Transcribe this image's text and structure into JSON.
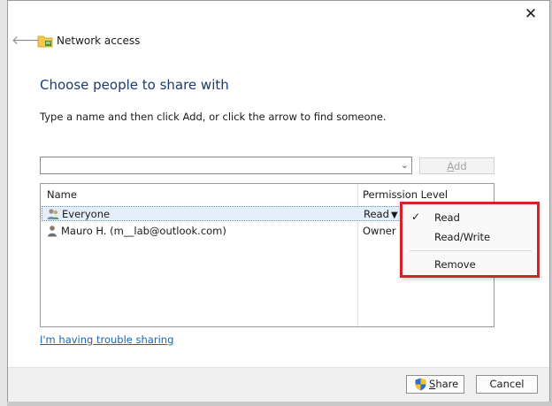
{
  "dialog": {
    "title": "Network access",
    "heading": "Choose people to share with",
    "instruction": "Type a name and then click Add, or click the arrow to find someone.",
    "name_input_value": "",
    "add_label_accel": "A",
    "add_label_rest": "dd"
  },
  "table": {
    "headers": {
      "name": "Name",
      "permission": "Permission Level"
    },
    "rows": [
      {
        "name": "Everyone",
        "permission": "Read"
      },
      {
        "name": "Mauro H. (m__lab@outlook.com)",
        "permission": "Owner"
      }
    ]
  },
  "context_menu": {
    "items": [
      {
        "label": "Read",
        "checked": true
      },
      {
        "label": "Read/Write",
        "checked": false
      },
      {
        "label": "Remove",
        "checked": false
      }
    ]
  },
  "trouble_link": "I'm having trouble sharing",
  "footer": {
    "share_accel": "S",
    "share_rest": "hare",
    "cancel_label": "Cancel"
  },
  "colors": {
    "heading": "#1c3a6e",
    "link": "#1a66b0",
    "highlight_border": "#d4222a",
    "selected_row": "#e6eff9"
  },
  "icons": {
    "back": "back-arrow-icon",
    "close": "close-icon",
    "wizard": "network-folder-icon",
    "group": "group-users-icon",
    "user": "user-icon",
    "shield": "uac-shield-icon",
    "check": "checkmark-icon"
  }
}
